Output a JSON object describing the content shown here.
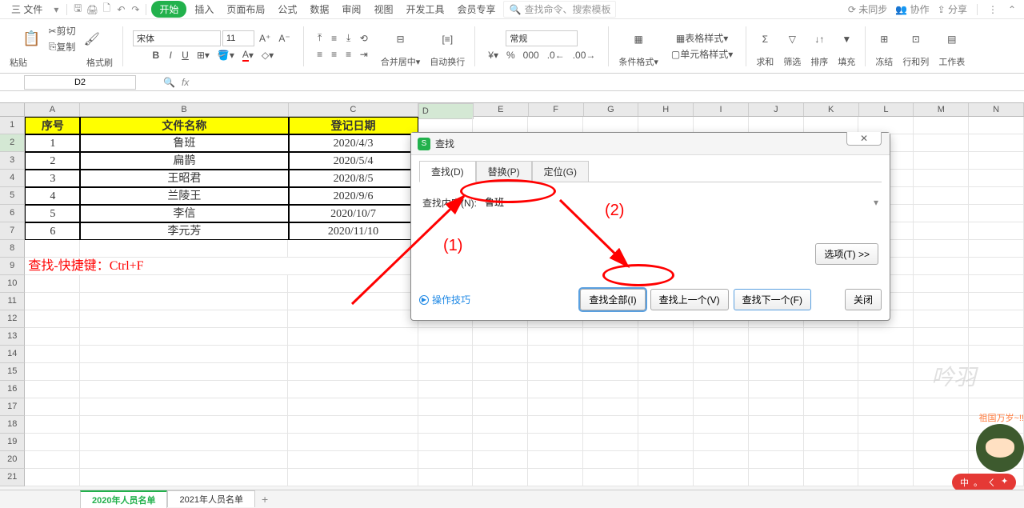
{
  "menu": {
    "file": "三 文件",
    "items": [
      "开始",
      "插入",
      "页面布局",
      "公式",
      "数据",
      "审阅",
      "视图",
      "开发工具",
      "会员专享"
    ],
    "search_placeholder": "查找命令、搜索模板",
    "right": {
      "sync": "未同步",
      "collab": "协作",
      "share": "分享"
    }
  },
  "ribbon": {
    "paste": "粘贴",
    "cut": "剪切",
    "copy": "复制",
    "format_painter": "格式刷",
    "font_name": "宋体",
    "font_size": "11",
    "merge": "合并居中",
    "wrap": "自动换行",
    "number_format": "常规",
    "cond_fmt": "条件格式",
    "table_style": "表格样式",
    "cell_style": "单元格样式",
    "sum": "求和",
    "filter": "筛选",
    "sort": "排序",
    "fill": "填充",
    "freeze": "冻结",
    "rowcol": "行和列",
    "worksheet": "工作表"
  },
  "formula_bar": {
    "name_box": "D2",
    "fx": "fx"
  },
  "grid": {
    "cols": [
      "A",
      "B",
      "C",
      "D",
      "E",
      "F",
      "G",
      "H",
      "I",
      "J",
      "K",
      "L",
      "M",
      "N"
    ],
    "widths": [
      70,
      265,
      165,
      70,
      70,
      70,
      70,
      70,
      70,
      70,
      70,
      70,
      70,
      70
    ],
    "headers": [
      "序号",
      "文件名称",
      "登记日期"
    ],
    "rows": [
      {
        "n": "1",
        "name": "鲁班",
        "date": "2020/4/3"
      },
      {
        "n": "2",
        "name": "扁鹊",
        "date": "2020/5/4"
      },
      {
        "n": "3",
        "name": "王昭君",
        "date": "2020/8/5"
      },
      {
        "n": "4",
        "name": "兰陵王",
        "date": "2020/9/6"
      },
      {
        "n": "5",
        "name": "李信",
        "date": "2020/10/7"
      },
      {
        "n": "6",
        "name": "李元芳",
        "date": "2020/11/10"
      }
    ],
    "note": "查找-快捷键：Ctrl+F",
    "selected_col": "D",
    "selected_row": 2
  },
  "dialog": {
    "title": "查找",
    "close": "✕",
    "tabs": [
      "查找(D)",
      "替换(P)",
      "定位(G)"
    ],
    "find_label": "查找内容(N):",
    "find_value": "鲁班",
    "options_btn": "选项(T) >>",
    "tips": "操作技巧",
    "btn_all": "查找全部(I)",
    "btn_prev": "查找上一个(V)",
    "btn_next": "查找下一个(F)",
    "btn_close": "关闭"
  },
  "annotations": {
    "l1": "(1)",
    "l2": "(2)"
  },
  "watermark": "吟羽",
  "mascot": {
    "bubble": "祖国万岁~!!",
    "badge_items": [
      "中",
      "。",
      "ㄑ",
      "✦"
    ]
  },
  "sheets": {
    "tabs": [
      "2020年人员名单",
      "2021年人员名单"
    ],
    "active": 0
  }
}
